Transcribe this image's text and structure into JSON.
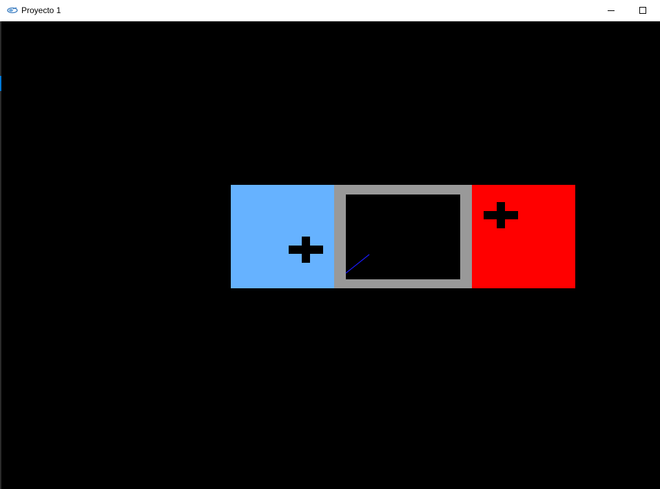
{
  "window": {
    "title": "Proyecto 1",
    "app_icon": "app-logo-icon",
    "controls": [
      "minimize-icon",
      "maximize-icon"
    ]
  },
  "canvas": {
    "background": "#000000",
    "panels": [
      {
        "name": "blue-panel",
        "color": "#66b2ff",
        "marker": "cross-icon"
      },
      {
        "name": "gray-frame-panel",
        "color": "#999999",
        "inner_color": "#000000"
      },
      {
        "name": "red-panel",
        "color": "#ff0000",
        "marker": "cross-icon"
      }
    ],
    "line_color": "#1a1aff"
  }
}
